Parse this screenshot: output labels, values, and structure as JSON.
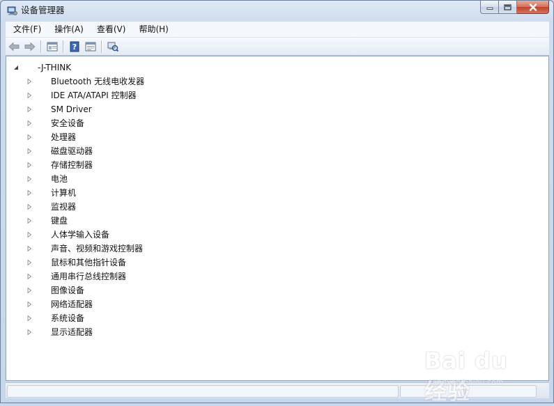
{
  "window": {
    "title": "设备管理器"
  },
  "menu": [
    {
      "label": "文件(F)"
    },
    {
      "label": "操作(A)"
    },
    {
      "label": "查看(V)"
    },
    {
      "label": "帮助(H)"
    }
  ],
  "tree": {
    "root": "-J-THINK",
    "items": [
      {
        "label": "Bluetooth 无线电收发器",
        "icon": "bluetooth-icon"
      },
      {
        "label": "IDE ATA/ATAPI 控制器",
        "icon": "ide-controller-icon"
      },
      {
        "label": "SM Driver",
        "icon": "computer-icon"
      },
      {
        "label": "安全设备",
        "icon": "security-key-icon"
      },
      {
        "label": "处理器",
        "icon": "processor-chip-icon"
      },
      {
        "label": "磁盘驱动器",
        "icon": "disk-drive-icon"
      },
      {
        "label": "存储控制器",
        "icon": "storage-controller-icon"
      },
      {
        "label": "电池",
        "icon": "battery-icon"
      },
      {
        "label": "计算机",
        "icon": "computer-icon"
      },
      {
        "label": "监视器",
        "icon": "monitor-icon"
      },
      {
        "label": "键盘",
        "icon": "keyboard-icon"
      },
      {
        "label": "人体学输入设备",
        "icon": "hid-icon"
      },
      {
        "label": "声音、视频和游戏控制器",
        "icon": "speaker-icon"
      },
      {
        "label": "鼠标和其他指针设备",
        "icon": "mouse-icon"
      },
      {
        "label": "通用串行总线控制器",
        "icon": "usb-icon"
      },
      {
        "label": "图像设备",
        "icon": "scanner-icon"
      },
      {
        "label": "网络适配器",
        "icon": "network-adapter-icon"
      },
      {
        "label": "系统设备",
        "icon": "system-device-icon"
      },
      {
        "label": "显示适配器",
        "icon": "display-adapter-icon"
      }
    ]
  },
  "watermark": {
    "text": "Bai du 经验",
    "sub": "jingyan.baidu.com"
  }
}
